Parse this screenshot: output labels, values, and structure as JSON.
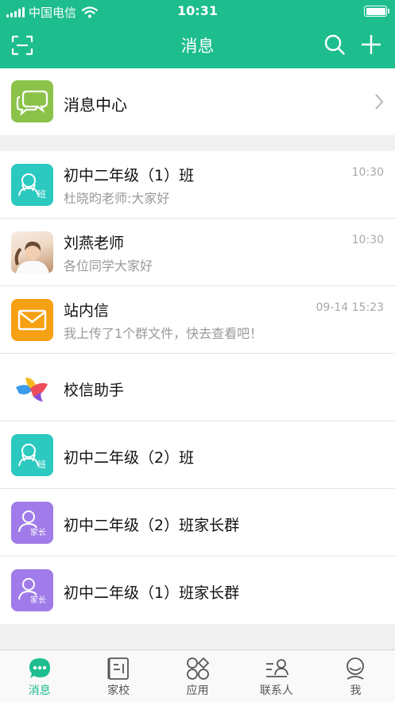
{
  "status_bar": {
    "carrier": "中国电信",
    "time": "10:31"
  },
  "nav": {
    "title": "消息",
    "icons": [
      "scan-icon",
      "search-icon",
      "plus-icon"
    ]
  },
  "message_center": {
    "label": "消息中心",
    "icon": "chat-bubbles-icon"
  },
  "conversations": [
    {
      "name": "初中二年级（1）班",
      "preview": "杜晓昀老师:大家好",
      "time": "10:30",
      "avatar": "class-icon"
    },
    {
      "name": "刘燕老师",
      "preview": "各位同学大家好",
      "time": "10:30",
      "avatar": "photo"
    },
    {
      "name": "站内信",
      "preview": "我上传了1个群文件，快去查看吧！",
      "time": "09-14 15:23",
      "avatar": "envelope-icon"
    },
    {
      "name": "校信助手",
      "preview": "",
      "time": "",
      "avatar": "bird-logo"
    },
    {
      "name": "初中二年级（2）班",
      "preview": "",
      "time": "",
      "avatar": "class-icon"
    },
    {
      "name": "初中二年级（2）班家长群",
      "preview": "",
      "time": "",
      "avatar": "parent-icon"
    },
    {
      "name": "初中二年级（1）班家长群",
      "preview": "",
      "time": "",
      "avatar": "parent-icon"
    }
  ],
  "badges": {
    "class": "班",
    "parent": "家长"
  },
  "tabs": [
    {
      "label": "消息",
      "icon": "message-icon",
      "active": true
    },
    {
      "label": "家校",
      "icon": "book-icon",
      "active": false
    },
    {
      "label": "应用",
      "icon": "apps-icon",
      "active": false
    },
    {
      "label": "联系人",
      "icon": "contacts-icon",
      "active": false
    },
    {
      "label": "我",
      "icon": "profile-icon",
      "active": false
    }
  ],
  "colors": {
    "brand": "#1dbd8e",
    "message_center": "#8bc24a",
    "class": "#2cc9c0",
    "mail": "#f6a113",
    "parent": "#a07be9"
  }
}
